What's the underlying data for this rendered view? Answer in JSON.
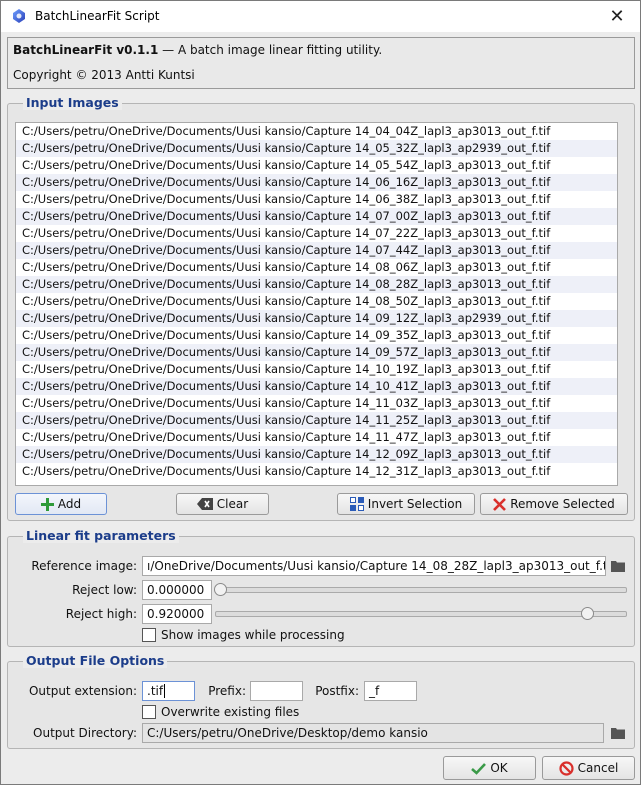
{
  "window": {
    "title": "BatchLinearFit Script"
  },
  "header": {
    "app_name": "BatchLinearFit v0.1.1",
    "tagline": " — A batch image linear fitting utility.",
    "copyright": "Copyright © 2013 Antti Kuntsi"
  },
  "input_images": {
    "title": "Input Images",
    "files": [
      "C:/Users/petru/OneDrive/Documents/Uusi kansio/Capture 14_04_04Z_lapl3_ap3013_out_f.tif",
      "C:/Users/petru/OneDrive/Documents/Uusi kansio/Capture 14_05_32Z_lapl3_ap2939_out_f.tif",
      "C:/Users/petru/OneDrive/Documents/Uusi kansio/Capture 14_05_54Z_lapl3_ap3013_out_f.tif",
      "C:/Users/petru/OneDrive/Documents/Uusi kansio/Capture 14_06_16Z_lapl3_ap3013_out_f.tif",
      "C:/Users/petru/OneDrive/Documents/Uusi kansio/Capture 14_06_38Z_lapl3_ap3013_out_f.tif",
      "C:/Users/petru/OneDrive/Documents/Uusi kansio/Capture 14_07_00Z_lapl3_ap3013_out_f.tif",
      "C:/Users/petru/OneDrive/Documents/Uusi kansio/Capture 14_07_22Z_lapl3_ap3013_out_f.tif",
      "C:/Users/petru/OneDrive/Documents/Uusi kansio/Capture 14_07_44Z_lapl3_ap3013_out_f.tif",
      "C:/Users/petru/OneDrive/Documents/Uusi kansio/Capture 14_08_06Z_lapl3_ap3013_out_f.tif",
      "C:/Users/petru/OneDrive/Documents/Uusi kansio/Capture 14_08_28Z_lapl3_ap3013_out_f.tif",
      "C:/Users/petru/OneDrive/Documents/Uusi kansio/Capture 14_08_50Z_lapl3_ap3013_out_f.tif",
      "C:/Users/petru/OneDrive/Documents/Uusi kansio/Capture 14_09_12Z_lapl3_ap2939_out_f.tif",
      "C:/Users/petru/OneDrive/Documents/Uusi kansio/Capture 14_09_35Z_lapl3_ap3013_out_f.tif",
      "C:/Users/petru/OneDrive/Documents/Uusi kansio/Capture 14_09_57Z_lapl3_ap3013_out_f.tif",
      "C:/Users/petru/OneDrive/Documents/Uusi kansio/Capture 14_10_19Z_lapl3_ap3013_out_f.tif",
      "C:/Users/petru/OneDrive/Documents/Uusi kansio/Capture 14_10_41Z_lapl3_ap3013_out_f.tif",
      "C:/Users/petru/OneDrive/Documents/Uusi kansio/Capture 14_11_03Z_lapl3_ap3013_out_f.tif",
      "C:/Users/petru/OneDrive/Documents/Uusi kansio/Capture 14_11_25Z_lapl3_ap3013_out_f.tif",
      "C:/Users/petru/OneDrive/Documents/Uusi kansio/Capture 14_11_47Z_lapl3_ap3013_out_f.tif",
      "C:/Users/petru/OneDrive/Documents/Uusi kansio/Capture 14_12_09Z_lapl3_ap3013_out_f.tif",
      "C:/Users/petru/OneDrive/Documents/Uusi kansio/Capture 14_12_31Z_lapl3_ap3013_out_f.tif"
    ],
    "buttons": {
      "add": "Add",
      "clear": "Clear",
      "invert": "Invert Selection",
      "remove": "Remove Selected"
    }
  },
  "linear_fit": {
    "title": "Linear fit parameters",
    "reference_label": "Reference image:",
    "reference_value": "ı/OneDrive/Documents/Uusi kansio/Capture 14_08_28Z_lapl3_ap3013_out_f.tif",
    "reject_low_label": "Reject low:",
    "reject_low_value": "0.000000",
    "reject_low_fraction": 0.0,
    "reject_high_label": "Reject high:",
    "reject_high_value": "0.920000",
    "reject_high_fraction": 0.92,
    "show_images_label": "Show images while processing",
    "show_images_checked": false
  },
  "output": {
    "title": "Output File Options",
    "extension_label": "Output extension:",
    "extension_value": ".tif",
    "prefix_label": "Prefix:",
    "prefix_value": "",
    "postfix_label": "Postfix:",
    "postfix_value": "_f",
    "overwrite_label": "Overwrite existing files",
    "overwrite_checked": false,
    "directory_label": "Output Directory:",
    "directory_value": "C:/Users/petru/OneDrive/Desktop/demo kansio"
  },
  "dialog": {
    "ok": "OK",
    "cancel": "Cancel"
  },
  "colors": {
    "group_title": "#1c3d8a",
    "add_icon": "#2e9a3a",
    "remove_icon": "#d9302c",
    "ok_icon": "#3a9a48",
    "cancel_icon": "#d9302c"
  }
}
